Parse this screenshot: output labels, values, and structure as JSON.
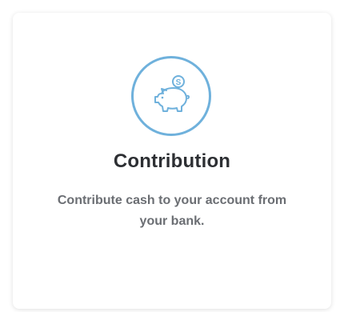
{
  "card": {
    "title": "Contribution",
    "description": "Contribute cash to your account from your bank.",
    "icon": "piggy-bank-icon",
    "accent_color": "#6fb1dc",
    "coin_symbol": "S"
  }
}
